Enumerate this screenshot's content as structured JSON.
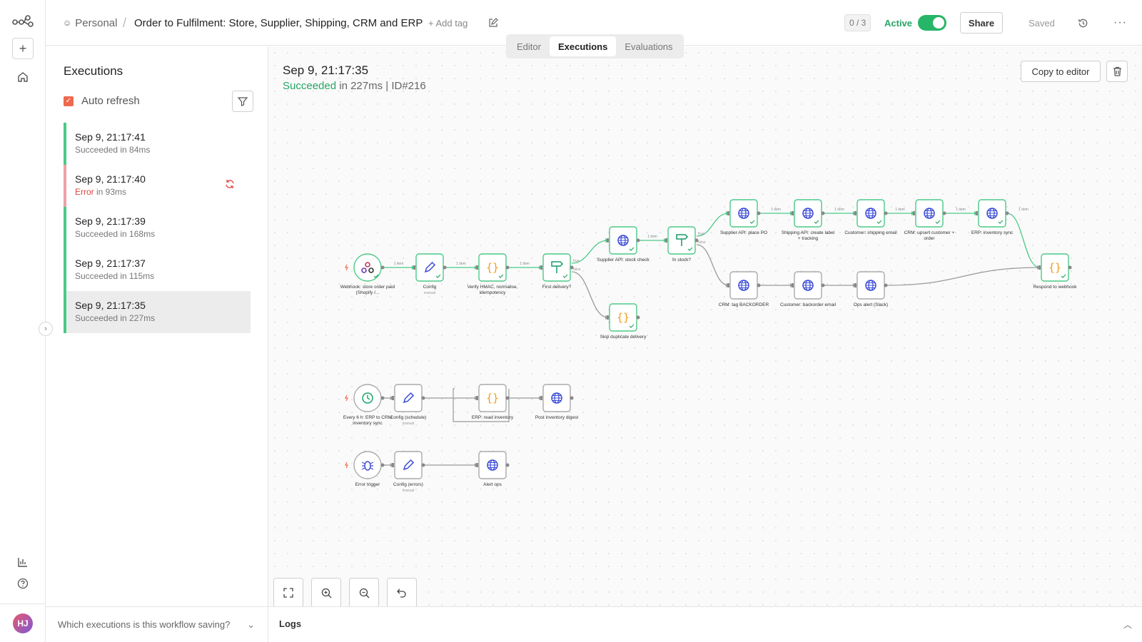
{
  "header": {
    "personal": "Personal",
    "separator": "/",
    "title": "Order to Fulfilment: Store, Supplier, Shipping, CRM and ERP",
    "add_tag": "+ Add tag",
    "counter": "0 / 3",
    "active_label": "Active",
    "active": true,
    "share": "Share",
    "saved": "Saved"
  },
  "tabs": [
    {
      "label": "Editor"
    },
    {
      "label": "Executions"
    },
    {
      "label": "Evaluations"
    }
  ],
  "panel": {
    "title": "Executions",
    "auto_refresh_label": "Auto refresh",
    "auto_refresh": true,
    "footer": "Which executions is this workflow saving?"
  },
  "executions": [
    {
      "time": "Sep 9, 21:17:41",
      "status_word": "Succeeded",
      "duration": " in 84ms",
      "state": "success"
    },
    {
      "time": "Sep 9, 21:17:40",
      "status_word": "Error",
      "duration": " in 93ms",
      "state": "error"
    },
    {
      "time": "Sep 9, 21:17:39",
      "status_word": "Succeeded",
      "duration": " in 168ms",
      "state": "success"
    },
    {
      "time": "Sep 9, 21:17:37",
      "status_word": "Succeeded",
      "duration": " in 115ms",
      "state": "success"
    },
    {
      "time": "Sep 9, 21:17:35",
      "status_word": "Succeeded",
      "duration": " in 227ms",
      "state": "success",
      "selected": true
    }
  ],
  "detail": {
    "date": "Sep 9, 21:17:35",
    "status": "Succeeded",
    "duration": " in 227ms | ID#216",
    "copy_button": "Copy to editor"
  },
  "logs": {
    "label": "Logs"
  },
  "colors": {
    "success": "#27a567",
    "error": "#e04444",
    "accent": "#ee6a4e",
    "node_border_success": "#4bc988"
  },
  "workflow": {
    "nodes": [
      {
        "id": "webhook",
        "label": "Webhook: store order paid (Shopify /...",
        "sublabel": "",
        "icon": "webhook-icon"
      },
      {
        "id": "config",
        "label": "Config",
        "sublabel": "manual",
        "icon": "pencil-icon"
      },
      {
        "id": "verify",
        "label": "Verify HMAC, normalise, idempotency",
        "sublabel": "",
        "icon": "code-icon"
      },
      {
        "id": "first",
        "label": "First delivery?",
        "sublabel": "",
        "icon": "if-icon"
      },
      {
        "id": "stock",
        "label": "Supplier API: stock check",
        "sublabel": "",
        "icon": "globe-icon"
      },
      {
        "id": "skip",
        "label": "Skip duplicate delivery",
        "sublabel": "",
        "icon": "code-icon"
      },
      {
        "id": "instock",
        "label": "In stock?",
        "sublabel": "",
        "icon": "if-icon"
      },
      {
        "id": "po",
        "label": "Supplier API: place PO",
        "sublabel": "",
        "icon": "globe-icon"
      },
      {
        "id": "ship",
        "label": "Shipping API: create label + tracking",
        "sublabel": "",
        "icon": "globe-icon"
      },
      {
        "id": "email",
        "label": "Customer: shipping email",
        "sublabel": "",
        "icon": "globe-icon"
      },
      {
        "id": "crm",
        "label": "CRM: upsert customer + order",
        "sublabel": "",
        "icon": "globe-icon"
      },
      {
        "id": "erp",
        "label": "ERP: inventory sync",
        "sublabel": "",
        "icon": "globe-icon"
      },
      {
        "id": "respond",
        "label": "Respond to webhook",
        "sublabel": "",
        "icon": "code-icon"
      },
      {
        "id": "backorder",
        "label": "CRM: tag BACKORDER",
        "sublabel": "",
        "icon": "globe-icon"
      },
      {
        "id": "bemail",
        "label": "Customer: backorder email",
        "sublabel": "",
        "icon": "globe-icon"
      },
      {
        "id": "ops",
        "label": "Ops alert (Slack)",
        "sublabel": "",
        "icon": "globe-icon"
      },
      {
        "id": "sched",
        "label": "Every 6 h: ERP to CRM inventory sync",
        "sublabel": "",
        "icon": "clock-icon"
      },
      {
        "id": "cfgsched",
        "label": "Config (schedule)",
        "sublabel": "manual",
        "icon": "pencil-icon"
      },
      {
        "id": "erpread",
        "label": "ERP: read inventory",
        "sublabel": "",
        "icon": "code-icon"
      },
      {
        "id": "digest",
        "label": "Post inventory digest",
        "sublabel": "",
        "icon": "globe-icon"
      },
      {
        "id": "errtrig",
        "label": "Error trigger",
        "sublabel": "",
        "icon": "bug-icon"
      },
      {
        "id": "cfgerr",
        "label": "Config (errors)",
        "sublabel": "manual",
        "icon": "pencil-icon"
      },
      {
        "id": "alert",
        "label": "Alert ops",
        "sublabel": "",
        "icon": "globe-icon"
      }
    ],
    "item_label": "1 item",
    "branch_true": "true",
    "branch_false": "false"
  }
}
